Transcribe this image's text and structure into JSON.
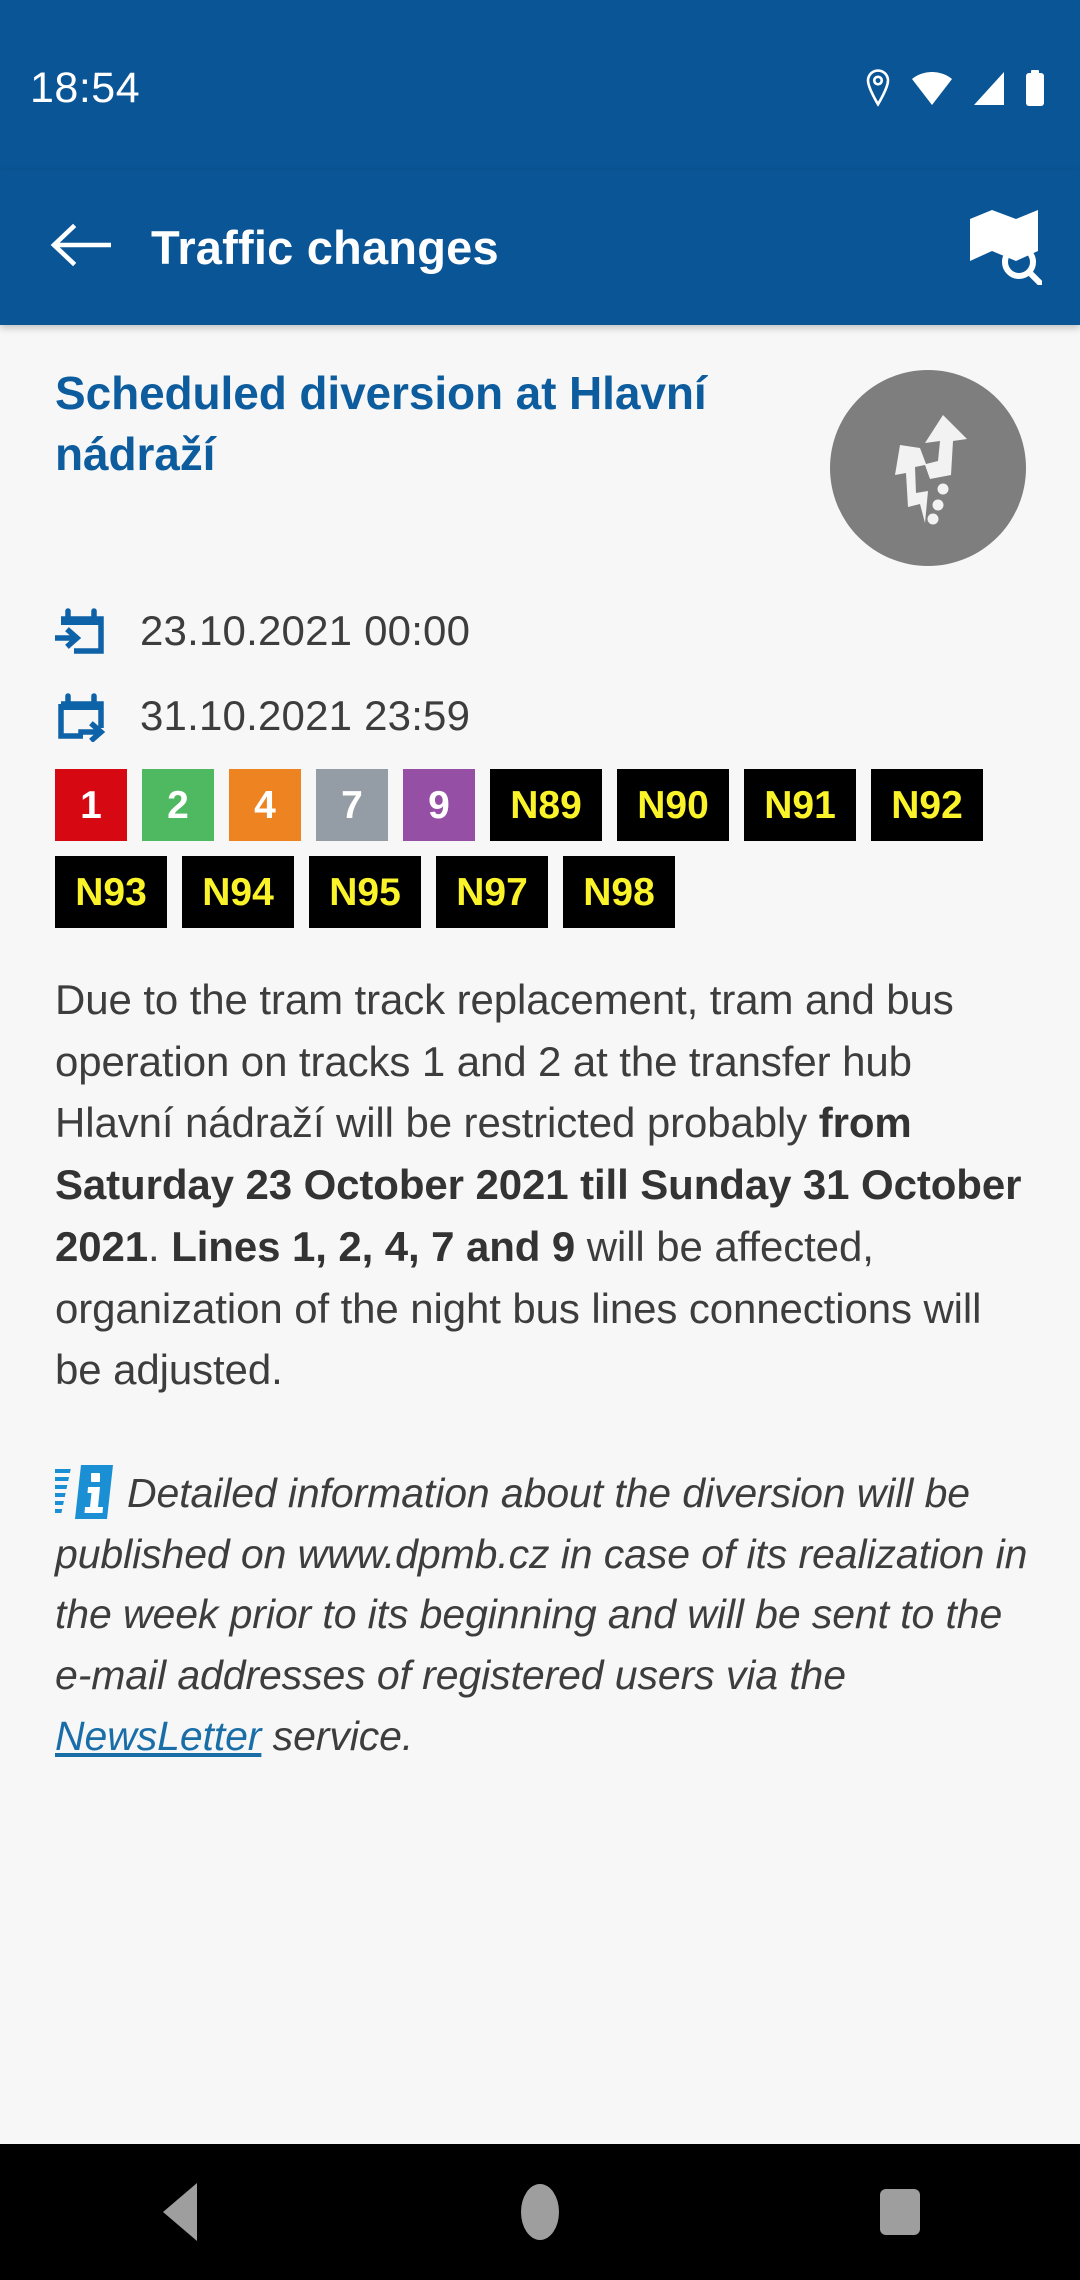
{
  "status_bar": {
    "time": "18:54",
    "icons": [
      "location-pin-icon",
      "wifi-icon",
      "signal-icon",
      "battery-icon"
    ]
  },
  "app_bar": {
    "title": "Traffic changes",
    "back_icon": "arrow-back-icon",
    "map_search_icon": "map-search-icon"
  },
  "item": {
    "title": "Scheduled diversion at Hlavní nádraží",
    "avatar_icon": "diversion-detour-icon",
    "valid_from": "23.10.2021 00:00",
    "valid_to": "31.10.2021 23:59",
    "from_icon": "calendar-start-icon",
    "to_icon": "calendar-end-icon",
    "lines": [
      {
        "label": "1",
        "bg": "#d60812",
        "fg": "#ffffff"
      },
      {
        "label": "2",
        "bg": "#4eb960",
        "fg": "#ffffff"
      },
      {
        "label": "4",
        "bg": "#ee8421",
        "fg": "#ffffff"
      },
      {
        "label": "7",
        "bg": "#949ca5",
        "fg": "#ffffff"
      },
      {
        "label": "9",
        "bg": "#9550a5",
        "fg": "#ffffff"
      },
      {
        "label": "N89",
        "bg": "#000000",
        "fg": "#fbf32a"
      },
      {
        "label": "N90",
        "bg": "#000000",
        "fg": "#fbf32a"
      },
      {
        "label": "N91",
        "bg": "#000000",
        "fg": "#fbf32a"
      },
      {
        "label": "N92",
        "bg": "#000000",
        "fg": "#fbf32a"
      },
      {
        "label": "N93",
        "bg": "#000000",
        "fg": "#fbf32a"
      },
      {
        "label": "N94",
        "bg": "#000000",
        "fg": "#fbf32a"
      },
      {
        "label": "N95",
        "bg": "#000000",
        "fg": "#fbf32a"
      },
      {
        "label": "N97",
        "bg": "#000000",
        "fg": "#fbf32a"
      },
      {
        "label": "N98",
        "bg": "#000000",
        "fg": "#fbf32a"
      }
    ],
    "description": {
      "part1": "Due to the tram track replacement, tram and bus operation on tracks 1 and 2 at the transfer hub Hlavní nádraží will be restricted probably ",
      "bold1": "from Saturday 23 October 2021 till Sunday 31 October 2021",
      "part2": ". ",
      "bold2": "Lines 1, 2, 4, 7 and 9",
      "part3": " will be affected, organization of the night bus lines connections will be adjusted."
    },
    "note": {
      "icon": "info-icon",
      "text_before_link": "Detailed information about the diversion will be published on www.dpmb.cz in case of its realization in the week prior to its beginning and will be sent to the e-mail addresses of registered users via the ",
      "link_label": "NewsLetter",
      "text_after_link": " service."
    }
  },
  "nav_bar": {
    "back": "back-nav-icon",
    "home": "home-nav-icon",
    "recents": "recents-nav-icon"
  },
  "colors": {
    "brand_blue": "#0a5596",
    "title_blue": "#0d5c9e",
    "link_blue": "#1a6ea8",
    "page_bg": "#f7f7f7"
  }
}
